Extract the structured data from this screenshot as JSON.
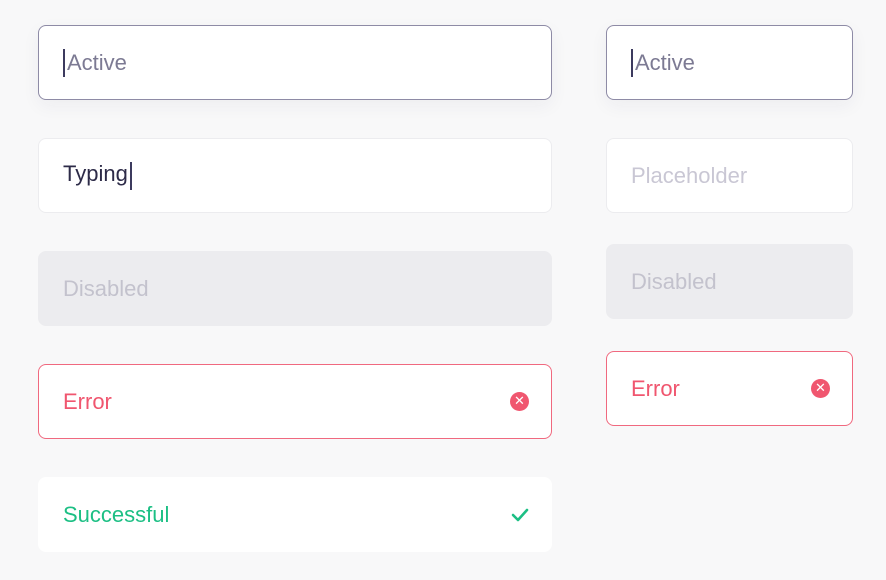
{
  "left_column": {
    "active": {
      "value": "Active"
    },
    "typing": {
      "value": "Typing"
    },
    "disabled": {
      "value": "Disabled"
    },
    "error": {
      "value": "Error",
      "icon": "error-circle-icon"
    },
    "success": {
      "value": "Successful",
      "icon": "checkmark-icon"
    }
  },
  "right_column": {
    "active": {
      "value": "Active"
    },
    "placeholder": {
      "placeholder": "Placeholder"
    },
    "disabled": {
      "value": "Disabled"
    },
    "error": {
      "value": "Error",
      "icon": "error-circle-icon"
    }
  },
  "colors": {
    "background": "#f8f8f9",
    "active_border": "#8e8ba6",
    "error": "#f0566f",
    "success": "#1cbf84",
    "disabled_fill": "#ececef"
  }
}
